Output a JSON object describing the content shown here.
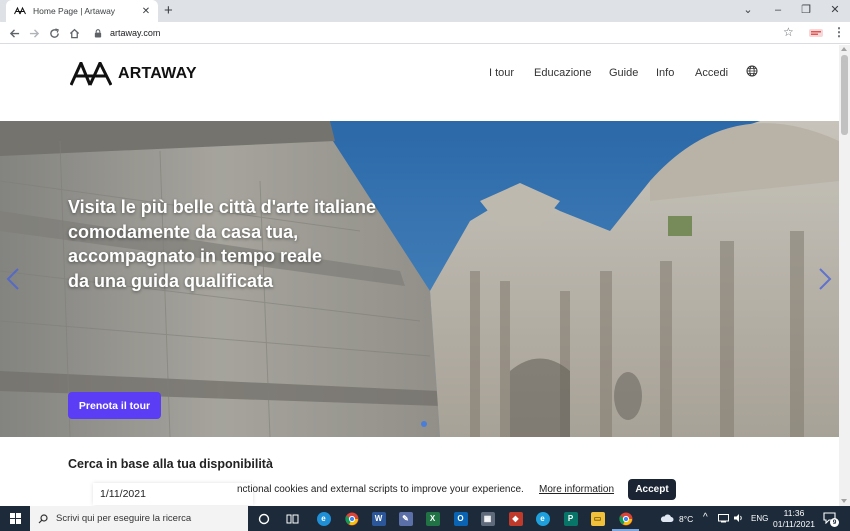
{
  "browser": {
    "tab_title": "Home Page | Artaway",
    "url": "artaway.com",
    "window_buttons": [
      "⌄",
      "–",
      "❐",
      "✕"
    ]
  },
  "header": {
    "brand": "ARTAWAY",
    "nav": [
      "I tour",
      "Educazione",
      "Guide",
      "Info",
      "Accedi"
    ]
  },
  "hero": {
    "title_lines": [
      "Visita le più belle città d'arte italiane",
      "comodamente da casa tua,",
      "accompagnato in tempo reale",
      "da una guida qualificata"
    ],
    "cta_label": "Prenota il tour"
  },
  "availability": {
    "title": "Cerca in base alla tua disponibilità",
    "date_value": "1/11/2021"
  },
  "cookie_banner": {
    "text": "nctional cookies and external scripts to improve your experience.",
    "more_label": "More information",
    "accept_label": "Accept"
  },
  "taskbar": {
    "search_placeholder": "Scrivi qui per eseguire la ricerca",
    "weather": "8°C",
    "language": "ENG",
    "time": "11:36",
    "date": "01/11/2021",
    "notifications": "9"
  },
  "colors": {
    "accent": "#5b3df5",
    "cookie_button": "#1b2433",
    "taskbar": "#1c2a3a"
  }
}
